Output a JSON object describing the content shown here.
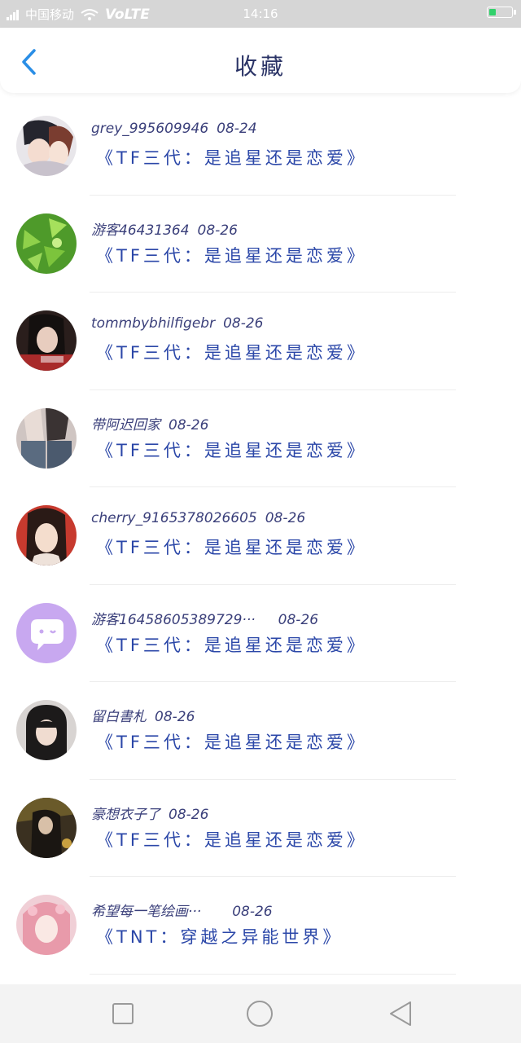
{
  "status": {
    "carrier": "中国移动",
    "network": "VoLTE",
    "time": "14:16",
    "battery_level": 0.25,
    "battery_color": "#31d16b"
  },
  "header": {
    "title": "收藏",
    "back_icon": "chevron-left-icon",
    "accent": "#2a8ee6"
  },
  "favorites": [
    {
      "user": "grey_995609946",
      "date": "08-24",
      "book": "《TF三代：是追星还是恋爱》"
    },
    {
      "user": "游客46431364",
      "date": "08-26",
      "book": "《TF三代：是追星还是恋爱》"
    },
    {
      "user": "tommbybhilfigebr",
      "date": "08-26",
      "book": "《TF三代：是追星还是恋爱》"
    },
    {
      "user": "带阿迟回家",
      "date": "08-26",
      "book": "《TF三代：是追星还是恋爱》"
    },
    {
      "user": "cherry_9165378026605",
      "date": "08-26",
      "book": "《TF三代：是追星还是恋爱》"
    },
    {
      "user": "游客16458605389729···",
      "date": "08-26",
      "book": "《TF三代：是追星还是恋爱》"
    },
    {
      "user": "留白書札",
      "date": "08-26",
      "book": "《TF三代：是追星还是恋爱》"
    },
    {
      "user": "豪想衣子了",
      "date": "08-26",
      "book": "《TF三代：是追星还是恋爱》"
    },
    {
      "user": "希望每一笔绘画···",
      "date": "08-26",
      "book": "《TNT：穿越之异能世界》"
    }
  ],
  "navbar": {
    "recent_icon": "square-icon",
    "home_icon": "circle-icon",
    "back_icon": "triangle-back-icon"
  }
}
